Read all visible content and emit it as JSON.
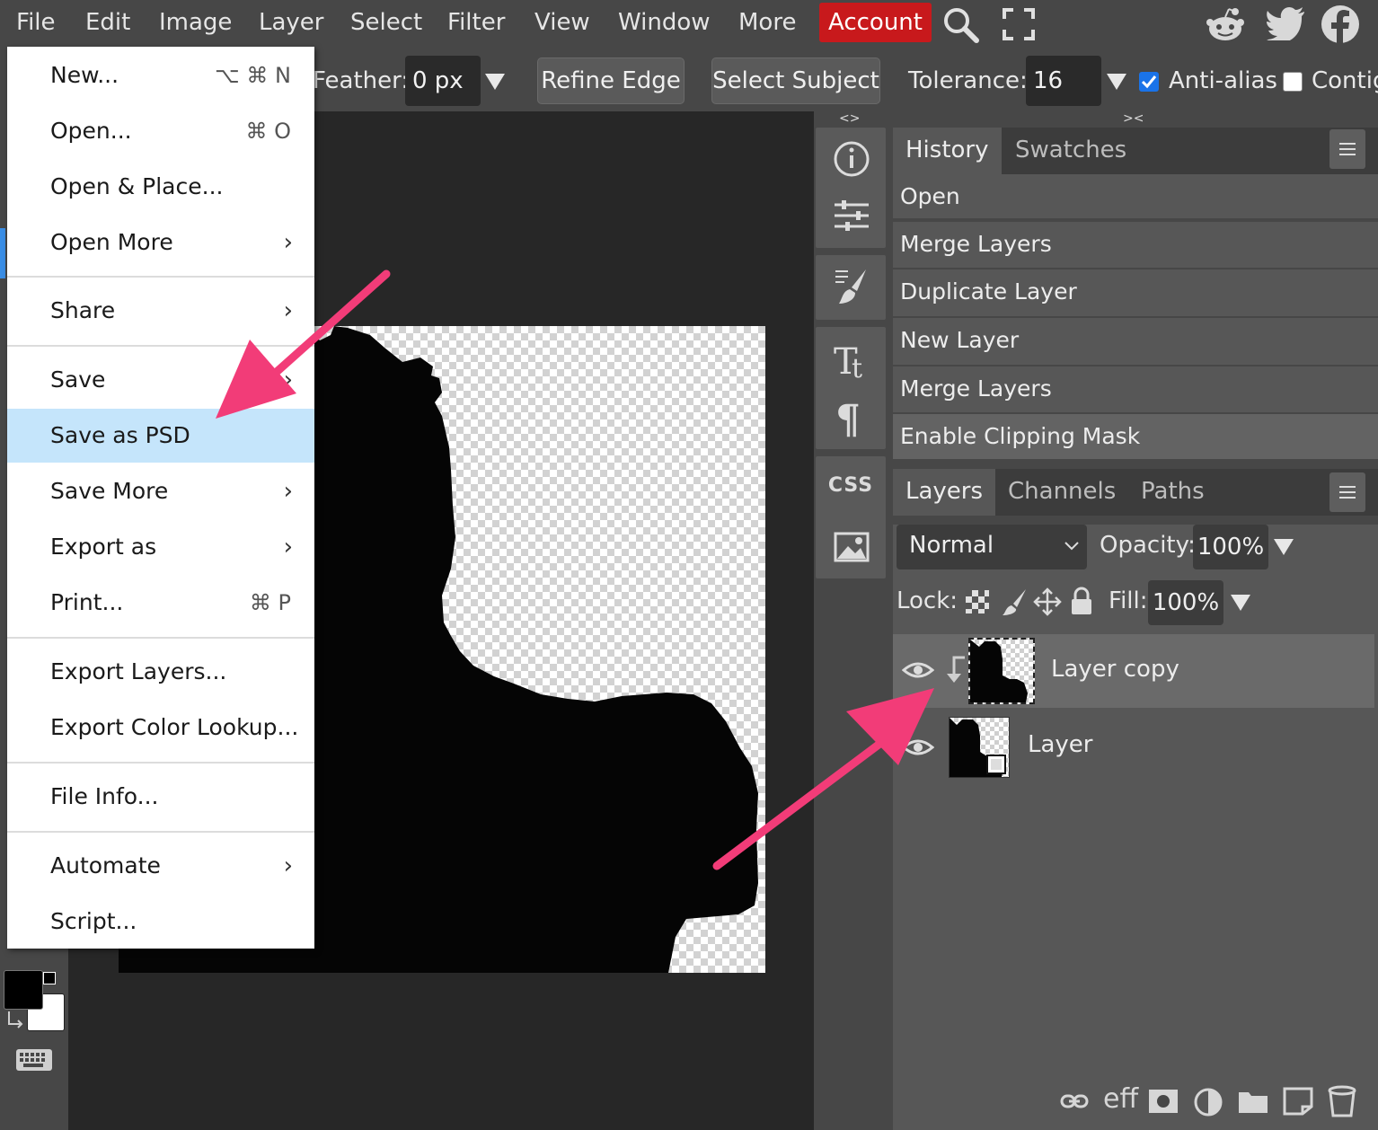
{
  "menubar": {
    "items": [
      "File",
      "Edit",
      "Image",
      "Layer",
      "Select",
      "Filter",
      "View",
      "Window",
      "More"
    ],
    "account": "Account"
  },
  "options": {
    "feather_label": "Feather:",
    "feather_value": "0 px",
    "refine_edge": "Refine Edge",
    "select_subject": "Select Subject",
    "tolerance_label": "Tolerance:",
    "tolerance_value": "16",
    "antialias_label": "Anti-alias",
    "antialias_checked": true,
    "contiguous_label": "Contig",
    "contiguous_checked": false
  },
  "file_menu": {
    "new": {
      "label": "New...",
      "shortcut": "⌥ ⌘ N"
    },
    "open": {
      "label": "Open...",
      "shortcut": "⌘ O"
    },
    "open_place": {
      "label": "Open & Place..."
    },
    "open_more": {
      "label": "Open More",
      "submenu": "›"
    },
    "share": {
      "label": "Share",
      "submenu": "›"
    },
    "save": {
      "label": "Save",
      "submenu": "›"
    },
    "save_psd": {
      "label": "Save as PSD"
    },
    "save_more": {
      "label": "Save More",
      "submenu": "›"
    },
    "export_as": {
      "label": "Export as",
      "submenu": "›"
    },
    "print": {
      "label": "Print...",
      "shortcut": "⌘ P"
    },
    "export_layers": {
      "label": "Export Layers..."
    },
    "export_lut": {
      "label": "Export Color Lookup..."
    },
    "file_info": {
      "label": "File Info..."
    },
    "automate": {
      "label": "Automate",
      "submenu": "›"
    },
    "script": {
      "label": "Script..."
    }
  },
  "panels": {
    "collapse_left": "<>",
    "collapse_right": "><",
    "history_tabs": [
      "History",
      "Swatches"
    ],
    "history_items": [
      "Open",
      "Merge Layers",
      "Duplicate Layer",
      "New Layer",
      "Merge Layers",
      "Enable Clipping Mask"
    ],
    "layers_tabs": [
      "Layers",
      "Channels",
      "Paths"
    ],
    "blend_mode": "Normal",
    "opacity_label": "Opacity:",
    "opacity_value": "100%",
    "lock_label": "Lock:",
    "fill_label": "Fill:",
    "fill_value": "100%",
    "layers": [
      "Layer copy",
      "Layer"
    ],
    "icon_css": "CSS",
    "footer_eff": "eff"
  },
  "colors": {
    "accent": "#c8191c",
    "highlight": "#c5e5fb",
    "arrow": "#f23c78",
    "checkbox": "#1a73e8"
  }
}
